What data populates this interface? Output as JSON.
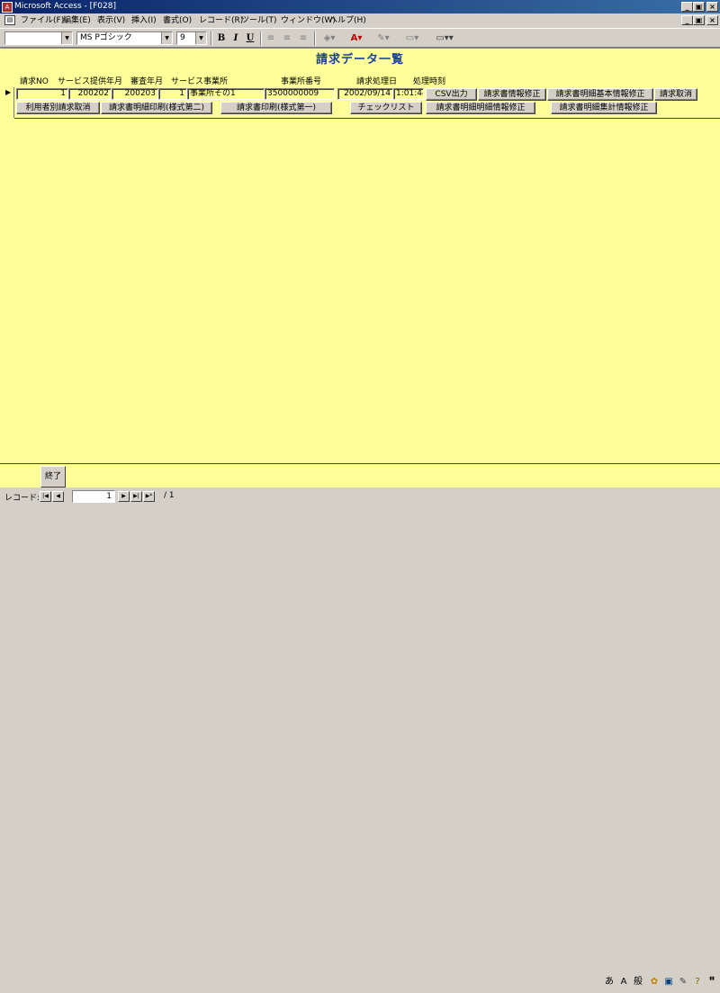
{
  "window": {
    "title": "Microsoft Access - [F028]",
    "min_glyph": "_",
    "restore_glyph": "▣",
    "close_glyph": "×"
  },
  "menu": [
    "ファイル(F)",
    "編集(E)",
    "表示(V)",
    "挿入(I)",
    "書式(O)",
    "レコード(R)",
    "ツール(T)",
    "ウィンドウ(W)",
    "ヘルプ(H)"
  ],
  "toolbar": {
    "object_combo": "",
    "font_name": "MS Pゴシック",
    "font_size": "9",
    "bold": "B",
    "italic": "I",
    "underline": "U"
  },
  "form": {
    "title": "請求データ一覧",
    "headers": [
      "請求NO",
      "サービス提供年月",
      "審査年月",
      "サービス事業所",
      "事業所番号",
      "請求処理日",
      "処理時刻"
    ],
    "record": {
      "claim_no": "1",
      "service_month": "200202",
      "review_month": "200203",
      "office_code": "1",
      "office_name": "事業所その1",
      "office_number": "3500000009",
      "process_date": "2002/09/14",
      "process_time": "1:01:44"
    },
    "row_buttons_1": [
      "CSV出力",
      "請求書情報修正",
      "請求書明細基本情報修正",
      "請求取消"
    ],
    "row_buttons_2": [
      "利用者別請求取消",
      "請求書明細印刷(様式第二)",
      "請求書印刷(様式第一)",
      "チェックリスト",
      "請求書明細明細情報修正",
      "請求書明細集計情報修正"
    ],
    "close_label": "終了"
  },
  "nav": {
    "label": "レコード:",
    "current": "1",
    "total": "/ 1"
  }
}
